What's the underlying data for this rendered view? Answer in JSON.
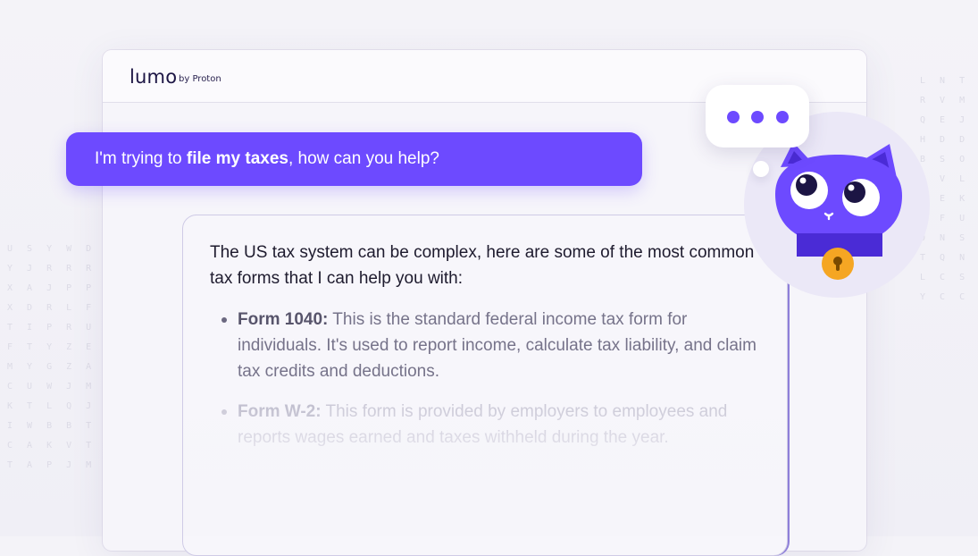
{
  "logo": {
    "name": "lumo",
    "by": "by Proton"
  },
  "user_message": {
    "pre": "I'm trying to ",
    "bold": "file my taxes",
    "post": ", how can you help?"
  },
  "assistant": {
    "intro": "The US tax system can be complex, here are some of the most common tax forms that I can help you with:",
    "items": [
      {
        "title": "Form 1040:",
        "text": " This is the standard federal income tax form for individuals. It's used to report income, calculate tax liability, and claim tax credits and deductions."
      },
      {
        "title": "Form W-2:",
        "text": " This form is provided by employers to employees and reports wages earned and taxes withheld during the year."
      }
    ]
  },
  "mascot": {
    "name": "cat-mascot-icon",
    "body_color": "#6d4aff",
    "lock_color": "#f5a623"
  },
  "background_letters": [
    "U S Y W D O",
    "Y J R R R D",
    "X A J P P R",
    "X D R L F I",
    "T I P R U P",
    "F T Y Z E D",
    "M Y G Z A B",
    "C U W J M W",
    "K T L Q J F",
    "I W B B T G",
    "C A K V T U",
    "T A P J M S"
  ],
  "background_letters_right": [
    "L N T B",
    "R V M F",
    "Q E J K",
    "H D D V",
    "B S O Q",
    "N V L T",
    "A E K P",
    "I F U S",
    "O N S O",
    "T Q N F",
    "L C S K",
    "Y C C A"
  ]
}
